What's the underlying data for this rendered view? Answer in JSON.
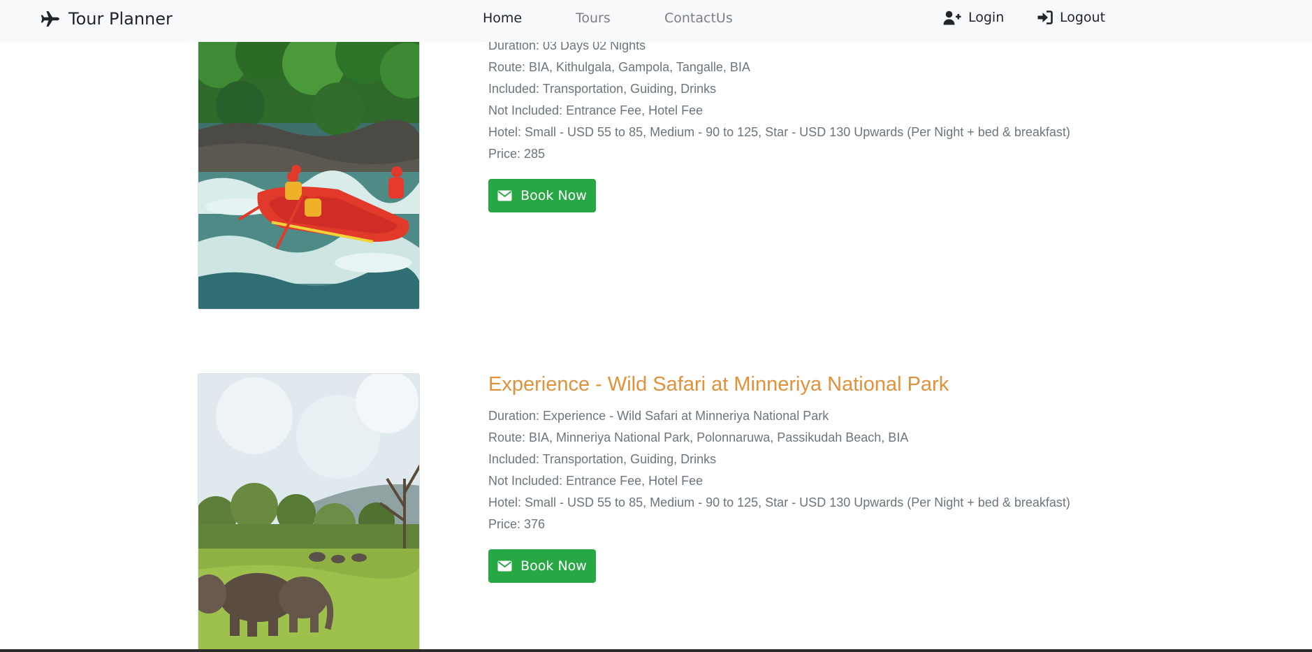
{
  "navbar": {
    "brand": "Tour Planner",
    "brand_icon": "plane-icon",
    "links": [
      {
        "label": "Home",
        "active": true
      },
      {
        "label": "Tours",
        "active": false
      },
      {
        "label": "ContactUs",
        "active": false
      }
    ],
    "login_label": "Login",
    "logout_label": "Logout"
  },
  "tours": [
    {
      "title": "",
      "image": "white-water-rafting-photo",
      "duration": "Duration: 03 Days 02 Nights",
      "route": "Route: BIA, Kithulgala, Gampola, Tangalle, BIA",
      "included": "Included: Transportation, Guiding, Drinks",
      "not_included": "Not Included: Entrance Fee, Hotel Fee",
      "hotel": "Hotel: Small - USD 55 to 85, Medium - 90 to 125, Star - USD 130 Upwards (Per Night + bed & breakfast)",
      "price": "Price: 285",
      "button_label": "Book Now"
    },
    {
      "title": "Experience - Wild Safari at Minneriya National Park",
      "image": "elephants-safari-photo",
      "duration": "Duration: Experience - Wild Safari at Minneriya National Park",
      "route": "Route: BIA, Minneriya National Park, Polonnaruwa, Passikudah Beach, BIA",
      "included": "Included: Transportation, Guiding, Drinks",
      "not_included": "Not Included: Entrance Fee, Hotel Fee",
      "hotel": "Hotel: Small - USD 55 to 85, Medium - 90 to 125, Star - USD 130 Upwards (Per Night + bed & breakfast)",
      "price": "Price: 376",
      "button_label": "Book Now"
    }
  ],
  "colors": {
    "navbar_bg": "#f8f9fa",
    "title": "#e2913a",
    "button": "#28a745",
    "text": "#6c757d"
  }
}
